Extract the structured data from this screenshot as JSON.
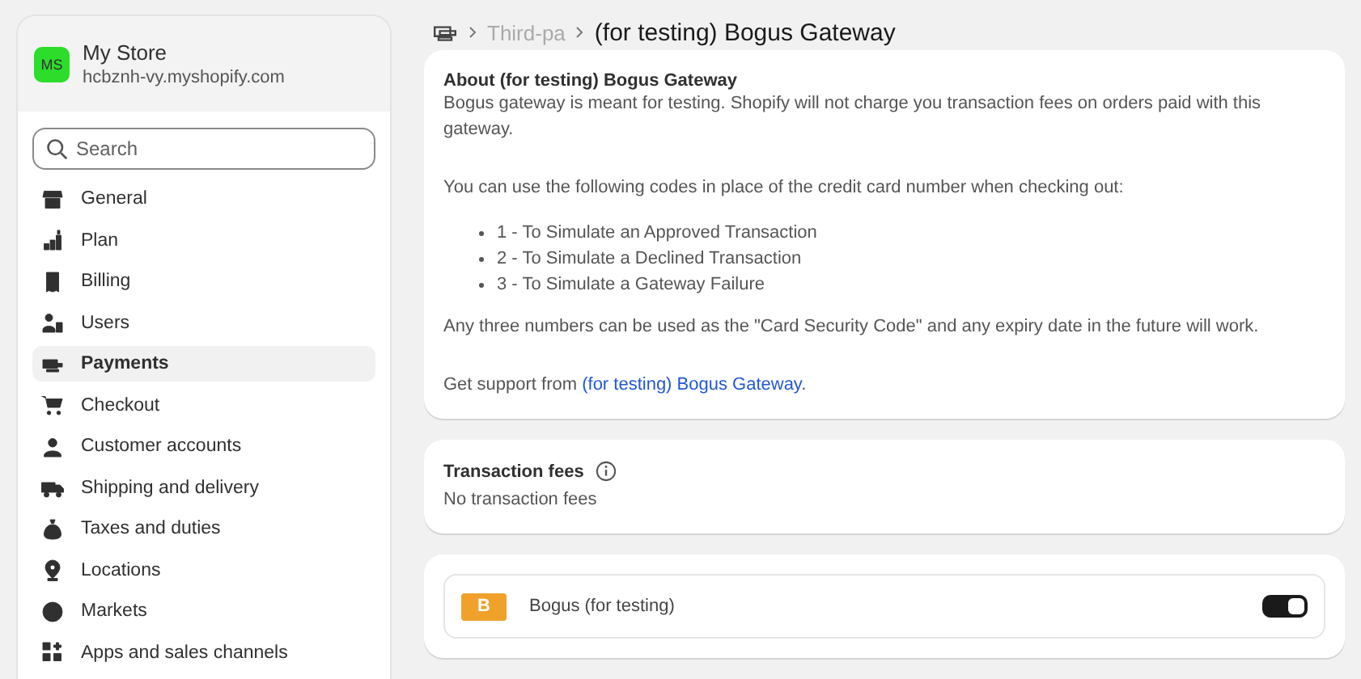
{
  "store": {
    "initials": "MS",
    "name": "My Store",
    "domain": "hcbznh-vy.myshopify.com"
  },
  "search": {
    "placeholder": "Search"
  },
  "sidebar": {
    "items": [
      {
        "label": "General",
        "selected": false
      },
      {
        "label": "Plan",
        "selected": false
      },
      {
        "label": "Billing",
        "selected": false
      },
      {
        "label": "Users",
        "selected": false
      },
      {
        "label": "Payments",
        "selected": true
      },
      {
        "label": "Checkout",
        "selected": false
      },
      {
        "label": "Customer accounts",
        "selected": false
      },
      {
        "label": "Shipping and delivery",
        "selected": false
      },
      {
        "label": "Taxes and duties",
        "selected": false
      },
      {
        "label": "Locations",
        "selected": false
      },
      {
        "label": "Markets",
        "selected": false
      },
      {
        "label": "Apps and sales channels",
        "selected": false
      }
    ]
  },
  "breadcrumb": {
    "parent": "Third-pa",
    "title": "(for testing) Bogus Gateway"
  },
  "about": {
    "heading": "About (for testing) Bogus Gateway",
    "intro": "Bogus gateway is meant for testing. Shopify will not charge you transaction fees on orders paid with this gateway.",
    "codes_intro": "You can use the following codes in place of the credit card number when checking out:",
    "codes": [
      "1 - To Simulate an Approved Transaction",
      "2 - To Simulate a Declined Transaction",
      "3 - To Simulate a Gateway Failure"
    ],
    "note": "Any three numbers can be used as the \"Card Security Code\" and any expiry date in the future will work.",
    "support_prefix": "Get support from",
    "support_link": "(for testing) Bogus Gateway",
    "support_suffix": "."
  },
  "fees": {
    "heading": "Transaction fees",
    "value": "No transaction fees"
  },
  "provider": {
    "logo": "B",
    "name": "Bogus (for testing)",
    "on": true
  }
}
